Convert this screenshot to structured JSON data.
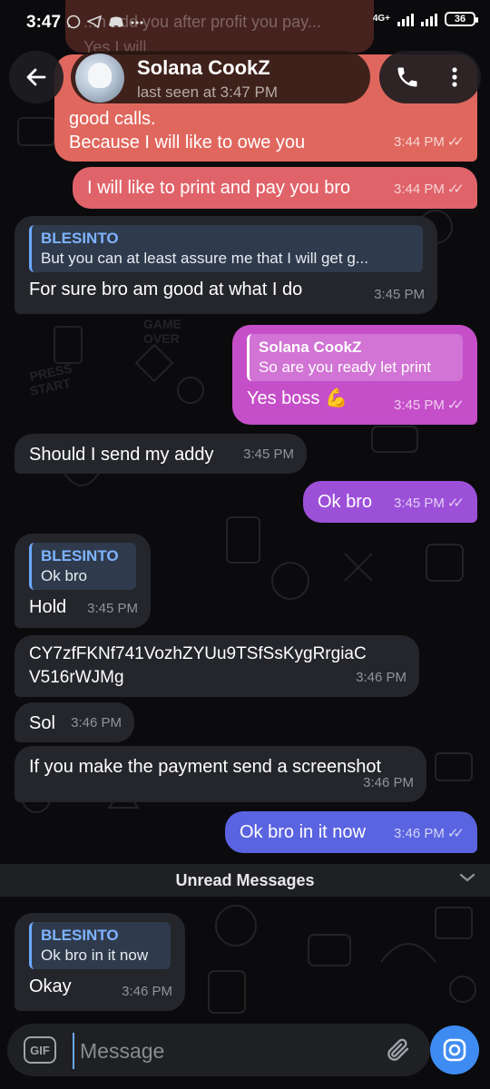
{
  "status_bar": {
    "time": "3:47",
    "left_icons": [
      "whatsapp-icon",
      "telegram-icon",
      "discord-icon",
      "more-dots-icon"
    ],
    "network_label": "4G+",
    "battery": "36"
  },
  "header": {
    "contact_name": "Solana CookZ",
    "last_seen": "last seen at 3:47 PM",
    "back_icon": "arrow-left-icon",
    "call_icon": "phone-icon",
    "menu_icon": "vertical-dots-icon"
  },
  "background_peek": {
    "line1": "...n add you after profit you pay...",
    "line2": "Yes I will..."
  },
  "messages": [
    {
      "dir": "out",
      "text": "good calls.\nBecause I will like to owe you",
      "time": "3:44 PM",
      "read": true,
      "color": "#e0675e"
    },
    {
      "dir": "out",
      "text": "I will like to print and pay you bro",
      "time": "3:44 PM",
      "read": true,
      "color": "#e0636a"
    },
    {
      "dir": "in",
      "reply_name": "BLESINTO",
      "reply_text": "But you can at least assure me that I will get g...",
      "text": "For sure bro am good at what I do",
      "time": "3:45 PM"
    },
    {
      "dir": "out",
      "reply_name": "Solana CookZ",
      "reply_text": "So are you ready let print",
      "text": "Yes boss 💪",
      "time": "3:45 PM",
      "read": true,
      "color": "#c54ec9"
    },
    {
      "dir": "in",
      "text": "Should I send my addy",
      "time": "3:45 PM"
    },
    {
      "dir": "out",
      "text": "Ok bro",
      "time": "3:45 PM",
      "read": true,
      "color": "#9c50d8"
    },
    {
      "dir": "in",
      "reply_name": "BLESINTO",
      "reply_text": "Ok bro",
      "text": "Hold",
      "time": "3:45 PM"
    },
    {
      "dir": "in",
      "text": "CY7zfFKNf741VozhZYUu9TSfSsKygRrgiaC\nV516rWJMg",
      "time": "3:46 PM"
    },
    {
      "dir": "in",
      "text": "Sol",
      "time": "3:46 PM"
    },
    {
      "dir": "in",
      "text": "If you make the payment send a screenshot",
      "time": "3:46 PM"
    },
    {
      "dir": "out",
      "text": "Ok bro in it now",
      "time": "3:46 PM",
      "read": true,
      "color": "#5a63e0"
    },
    {
      "dir": "in",
      "reply_name": "BLESINTO",
      "reply_text": "Ok bro in it now",
      "text": "Okay",
      "time": "3:46 PM"
    }
  ],
  "unread_label": "Unread Messages",
  "composer": {
    "gif_label": "GIF",
    "placeholder": "Message",
    "attach_icon": "paperclip-icon",
    "camera_icon": "camera-icon",
    "accent": "#3e8cf1"
  }
}
